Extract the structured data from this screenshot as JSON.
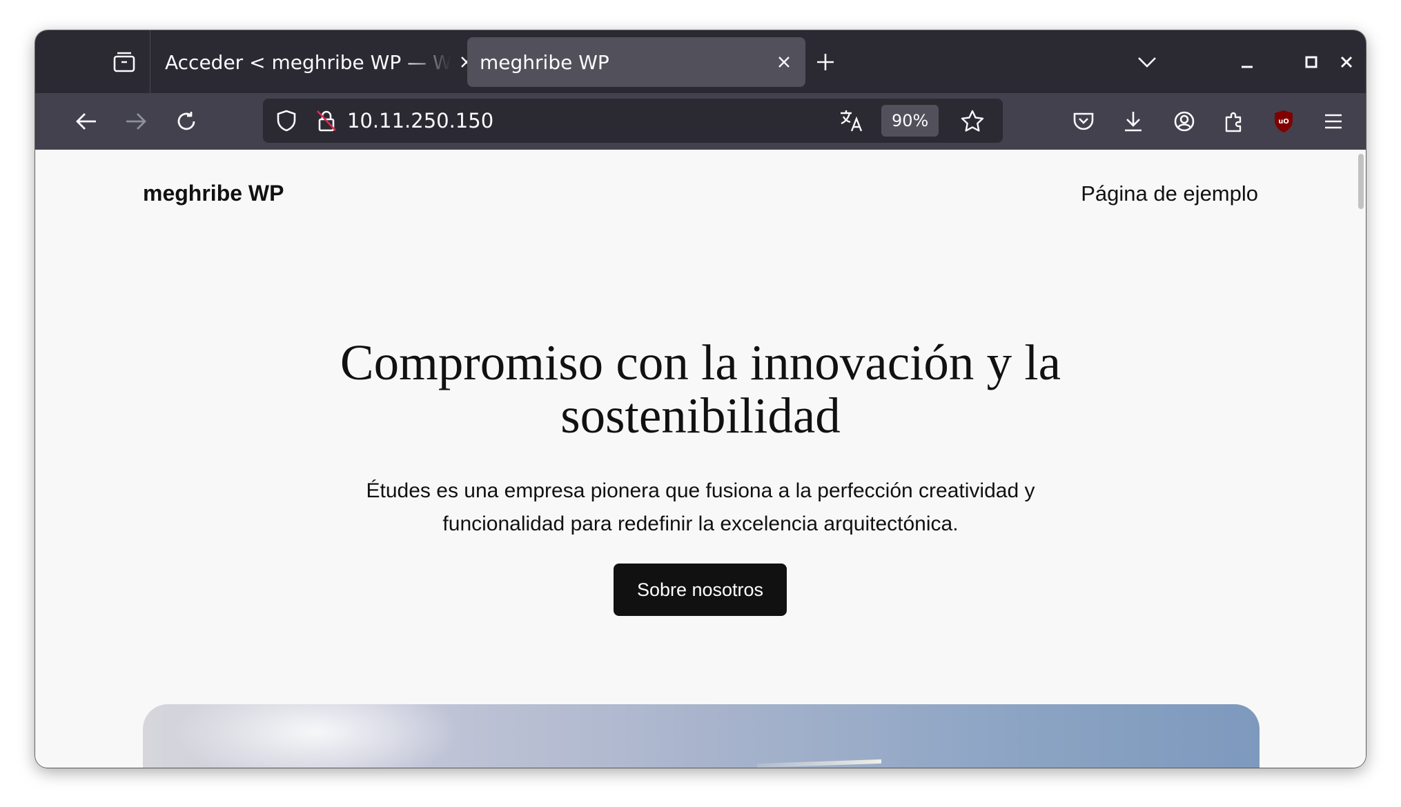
{
  "browser": {
    "tabs": [
      {
        "title": "Acceder < meghribe WP — WordPress",
        "active": false
      },
      {
        "title": "meghribe WP",
        "active": true
      }
    ],
    "url": "10.11.250.150",
    "zoom": "90%",
    "colors": {
      "tabbar": "#2b2a33",
      "toolbar": "#42414d",
      "active_tab": "#52515b",
      "ublock": "#800000"
    },
    "icons": [
      "tab-manager-icon",
      "close-icon",
      "plus-icon",
      "chevron-down-icon",
      "minimize-icon",
      "maximize-icon",
      "close-window-icon",
      "back-arrow-icon",
      "forward-arrow-icon",
      "reload-icon",
      "shield-icon",
      "insecure-lock-icon",
      "translate-icon",
      "star-icon",
      "pocket-icon",
      "download-icon",
      "account-icon",
      "extensions-icon",
      "ublock-icon",
      "hamburger-menu-icon"
    ]
  },
  "page": {
    "site_title": "meghribe WP",
    "nav_link": "Página de ejemplo",
    "hero": {
      "heading": "Compromiso con la innovación y la sostenibilidad",
      "text": "Études es una empresa pionera que fusiona a la perfección creatividad y funcionalidad para redefinir la excelencia arquitectónica.",
      "button": "Sobre nosotros"
    },
    "colors": {
      "background": "#f8f8f8",
      "text": "#111111",
      "button_bg": "#111111",
      "button_text": "#ffffff"
    }
  }
}
